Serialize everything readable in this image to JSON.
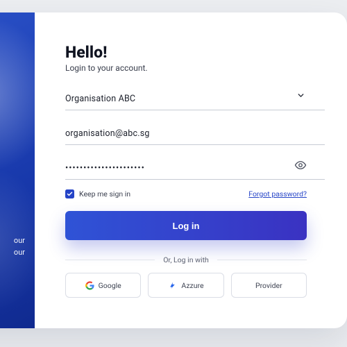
{
  "hero": {
    "line1": "our",
    "line2": "our"
  },
  "form": {
    "heading": "Hello!",
    "subheading": "Login to your account.",
    "org_value": "Organisation ABC",
    "email_value": "organisation@abc.sg",
    "password_value": "••••••••••••••••••••••",
    "keep_label": "Keep me sign in",
    "keep_checked": true,
    "forgot_label": "Forgot password?",
    "login_label": "Log in",
    "or_label": "Or, Log in with",
    "providers": {
      "google": "Google",
      "azzure": "Azzure",
      "provider": "Provider"
    }
  },
  "colors": {
    "primary": "#2544c7",
    "hero_grad_from": "#2b52c9",
    "hero_grad_to": "#102a8f"
  }
}
